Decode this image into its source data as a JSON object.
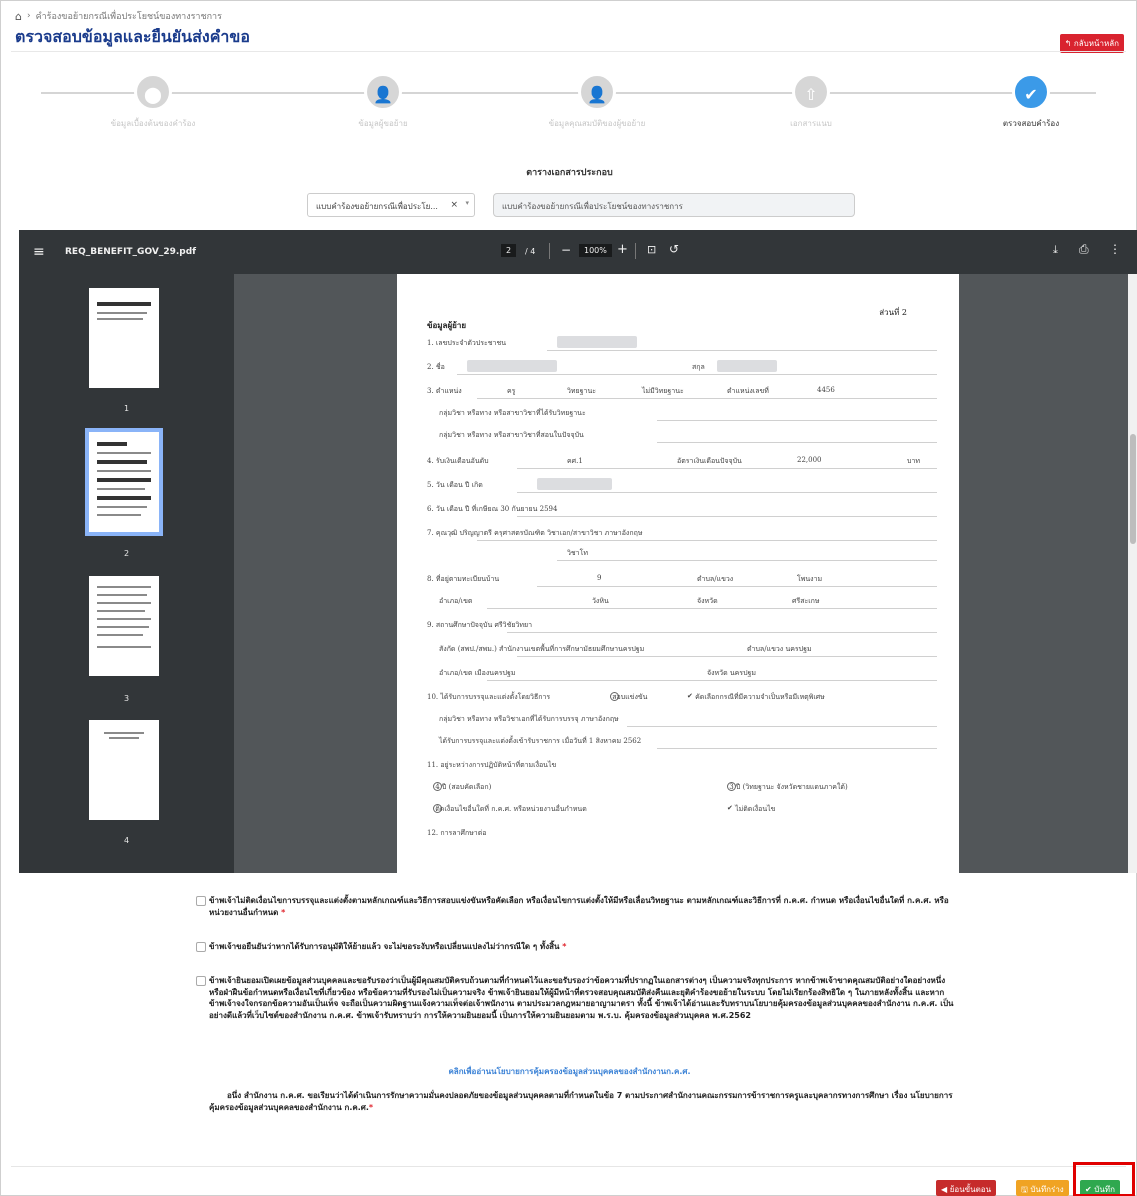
{
  "breadcrumb": {
    "home_icon": "home-icon",
    "separator": "›",
    "item": "คำร้องขอย้ายกรณีเพื่อประโยชน์ของทางราชการ"
  },
  "page_title": "ตรวจสอบข้อมูลและยืนยันส่งคำขอ",
  "back_button": "↰ กลับหน้าหลัก",
  "steps": [
    {
      "label": "ข้อมูลเบื้องต้นของคำร้อง",
      "icon": "map-pin-icon"
    },
    {
      "label": "ข้อมูลผู้ขอย้าย",
      "icon": "user-icon"
    },
    {
      "label": "ข้อมูลคุณสมบัติของผู้ขอย้าย",
      "icon": "user-check-icon"
    },
    {
      "label": "เอกสารแนบ",
      "icon": "upload-icon"
    },
    {
      "label": "ตรวจสอบคำร้อง",
      "icon": "check-icon"
    }
  ],
  "attachments": {
    "title": "ตารางเอกสารประกอบ",
    "selected_doc": "แบบคำร้องขอย้ายกรณีเพื่อประโย...",
    "doc_name": "แบบคำร้องขอย้ายกรณีเพื่อประโยชน์ของทางราชการ"
  },
  "viewer": {
    "filename": "REQ_BENEFIT_GOV_29.pdf",
    "current_page": "2",
    "total_pages": "/ 4",
    "zoom": "100%",
    "thumb_labels": [
      "1",
      "2",
      "3",
      "4"
    ]
  },
  "pdf": {
    "part": "ส่วนที่ 2",
    "heading": "ข้อมูลผู้ย้าย",
    "l1": "1.  เลขประจำตัวประชาชน",
    "l2a": "2.  ชื่อ",
    "l2b": "สกุล",
    "l3a": "3.  ตำแหน่ง",
    "l3b": "ครู",
    "l3c": "วิทยฐานะ",
    "l3d": "ไม่มีวิทยฐานะ",
    "l3e": "ตำแหน่งเลขที่",
    "l3f": "4456",
    "l3g": "กลุ่มวิชา หรือทาง หรือสาขาวิชาที่ได้รับวิทยฐานะ",
    "l3h": "กลุ่มวิชา หรือทาง หรือสาขาวิชาที่สอนในปัจจุบัน",
    "l4a": "4.  รับเงินเดือนอันดับ",
    "l4b": "คศ.1",
    "l4c": "อัตราเงินเดือนปัจจุบัน",
    "l4d": "22,000",
    "l4e": "บาท",
    "l5": "5.  วัน เดือน ปี เกิด",
    "l6": "6.  วัน เดือน ปี ที่เกษียณ  30 กันยายน 2594",
    "l7a": "7.  คุณวุฒิ  ปริญญาตรี  ครุศาสตรบัณฑิต  วิชาเอก/สาขาวิชา  ภาษาอังกฤษ",
    "l7b": "วิชาโท",
    "l8a": "8.  ที่อยู่ตามทะเบียนบ้าน",
    "l8b": "9",
    "l8c": "ตำบล/แขวง",
    "l8d": "โพนงาม",
    "l8e": "อำเภอ/เขต",
    "l8f": "วังหิน",
    "l8g": "จังหวัด",
    "l8h": "ศรีสะเกษ",
    "l9a": "9.  สถานศึกษาปัจจุบัน  ศรีวิชัยวิทยา",
    "l9b": "สังกัด (สพป./สพม.)  สำนักงานเขตพื้นที่การศึกษามัธยมศึกษานครปฐม",
    "l9c": "ตำบล/แขวง  นครปฐม",
    "l9d": "อำเภอ/เขต  เมืองนครปฐม",
    "l9e": "จังหวัด  นครปฐม",
    "l10a": "10.  ได้รับการบรรจุและแต่งตั้งโดยวิธีการ",
    "l10b": "สอบแข่งขัน",
    "l10c": "คัดเลือกกรณีที่มีความจำเป็นหรือมีเหตุพิเศษ",
    "l10d": "กลุ่มวิชา หรือทาง หรือวิชาเอกที่ได้รับการบรรจุ  ภาษาอังกฤษ",
    "l10e": "ได้รับการบรรจุและแต่งตั้งเข้ารับราชการ เมื่อวันที่  1 สิงหาคม 2562",
    "l11": "11.  อยู่ระหว่างการปฏิบัติหน้าที่ตามเงื่อนไข",
    "l11a": "4 ปี (สอบคัดเลือก)",
    "l11b": "3 ปี (วิทยฐานะ จังหวัดชายแดนภาคใต้)",
    "l11c": "ติดเงื่อนไขอื่นใดที่ ก.ค.ศ. หรือหน่วยงานอื่นกำหนด",
    "l11d": "ไม่ติดเงื่อนไข",
    "l12": "12.  การลาศึกษาต่อ"
  },
  "consents": [
    {
      "text": "ข้าพเจ้าไม่ติดเงื่อนไขการบรรจุและแต่งตั้งตามหลักเกณฑ์และวิธีการสอบแข่งขันหรือคัดเลือก หรือเงื่อนไขการแต่งตั้งให้มีหรือเลื่อนวิทยฐานะ ตามหลักเกณฑ์และวิธีการที่ ก.ค.ศ. กำหนด หรือเงื่อนไขอื่นใดที่ ก.ค.ศ. หรือหน่วยงานอื่นกำหนด",
      "req": " *"
    },
    {
      "text": "ข้าพเจ้าขอยืนยันว่าหากได้รับการอนุมัติให้ย้ายแล้ว จะไม่ขอระงับหรือเปลี่ยนแปลงไม่ว่ากรณีใด ๆ ทั้งสิ้น",
      "req": " *"
    },
    {
      "text": "ข้าพเจ้ายินยอมเปิดเผยข้อมูลส่วนบุคคลและขอรับรองว่าเป็นผู้มีคุณสมบัติครบถ้วนตามที่กำหนดไว้และขอรับรองว่าข้อความที่ปรากฏในเอกสารต่างๆ เป็นความจริงทุกประการ หากข้าพเจ้าขาดคุณสมบัติอย่างใดอย่างหนึ่ง หรือฝ่าฝืนข้อกำหนดหรือเงื่อนไขที่เกี่ยวข้อง หรือข้อความที่รับรองไม่เป็นความจริง ข้าพเจ้ายินยอมให้ผู้มีหน้าที่ตรวจสอบคุณสมบัติส่งคืนและยุติคำร้องขอย้ายในระบบ โดยไม่เรียกร้องสิทธิใด ๆ ในภายหลังทั้งสิ้น และหากข้าพเจ้าจงใจกรอกข้อความอันเป็นเท็จ จะถือเป็นความผิดฐานแจ้งความเท็จต่อเจ้าพนักงาน ตามประมวลกฎหมายอาญามาตรา ทั้งนี้ ข้าพเจ้าได้อ่านและรับทราบนโยบายคุ้มครองข้อมูลส่วนบุคคลของสำนักงาน ก.ค.ศ. เป็นอย่างดีแล้วที่เว็บไซต์ของสำนักงาน ก.ค.ศ. ข้าพเจ้ารับทราบว่า การให้ความยินยอมนี้ เป็นการให้ความยินยอมตาม พ.ร.บ. คุ้มครองข้อมูลส่วนบุคคล พ.ศ.2562",
      "req": ""
    }
  ],
  "policy_link": "คลิกเพื่ออ่านนโยบายการคุ้มครองข้อมูลส่วนบุคคลของสำนักงานก.ค.ศ.",
  "notice": "อนึ่ง สำนักงาน ก.ค.ศ. ขอเรียนว่าได้ดำเนินการรักษาความมั่นคงปลอดภัยของข้อมูลส่วนบุคคลตามที่กำหนดในข้อ 7 ตามประกาศสำนักงานคณะกรรมการข้าราชการครูและบุคลากรทางการศึกษา เรื่อง นโยบายการคุ้มครองข้อมูลส่วนบุคคลของสำนักงาน ก.ค.ศ.",
  "notice_req": "*",
  "footer": {
    "back": "◀ ย้อนขั้นตอน",
    "draft": "🖫 บันทึกร่าง",
    "save": "✔ บันทึก"
  }
}
